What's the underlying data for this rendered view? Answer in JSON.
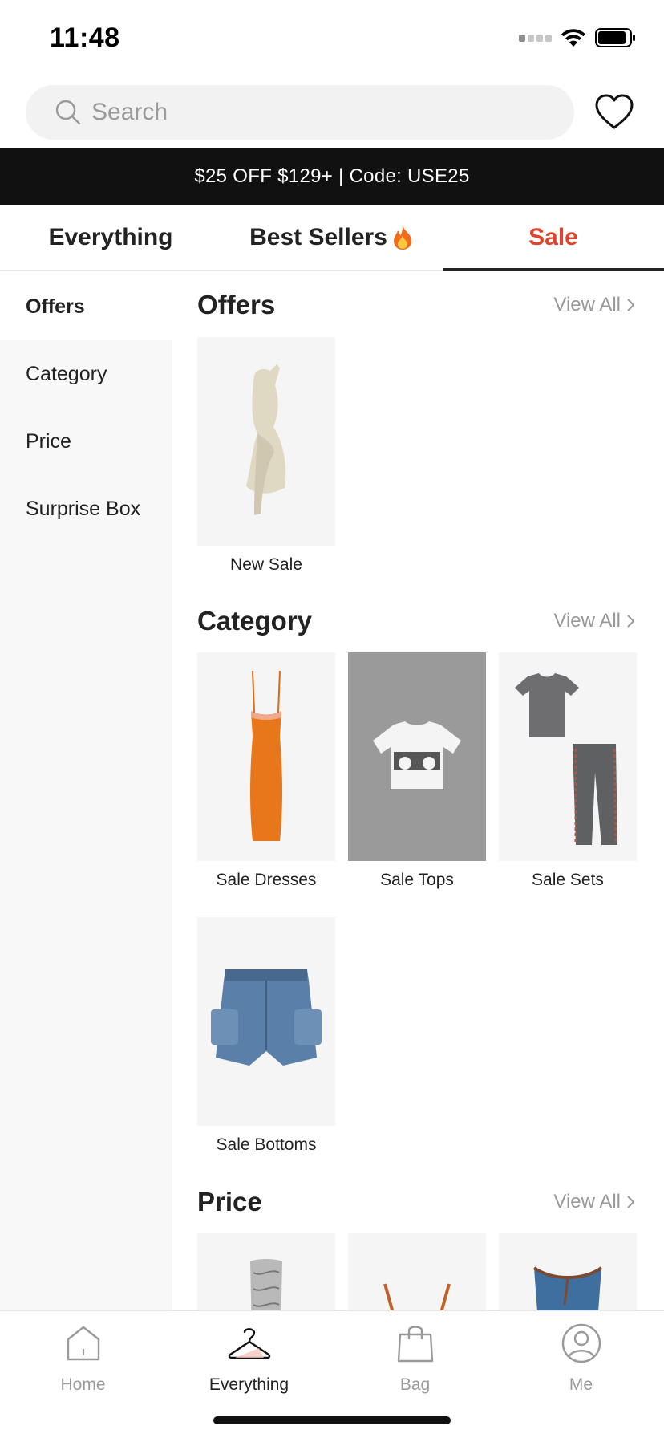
{
  "status_bar": {
    "time": "11:48"
  },
  "search": {
    "placeholder": "Search"
  },
  "promo": {
    "text": "$25 OFF $129+ | Code: USE25"
  },
  "tabs": [
    {
      "label": "Everything"
    },
    {
      "label": "Best Sellers"
    },
    {
      "label": "Sale",
      "active": true
    }
  ],
  "sidebar": {
    "items": [
      {
        "label": "Offers",
        "active": true
      },
      {
        "label": "Category"
      },
      {
        "label": "Price"
      },
      {
        "label": "Surprise Box"
      }
    ]
  },
  "sections": {
    "offers": {
      "title": "Offers",
      "view_all": "View All",
      "items": [
        {
          "label": "New Sale"
        }
      ]
    },
    "category": {
      "title": "Category",
      "view_all": "View All",
      "items": [
        {
          "label": "Sale Dresses"
        },
        {
          "label": "Sale Tops"
        },
        {
          "label": "Sale Sets"
        },
        {
          "label": "Sale Bottoms"
        }
      ]
    },
    "price": {
      "title": "Price",
      "view_all": "View All"
    }
  },
  "bottom_nav": {
    "items": [
      {
        "label": "Home",
        "icon": "home-icon"
      },
      {
        "label": "Everything",
        "icon": "hanger-icon",
        "active": true
      },
      {
        "label": "Bag",
        "icon": "bag-icon"
      },
      {
        "label": "Me",
        "icon": "user-icon"
      }
    ]
  },
  "colors": {
    "sale_accent": "#e0432b",
    "banner_bg": "#111111",
    "sidebar_bg": "#f8f8f8"
  }
}
